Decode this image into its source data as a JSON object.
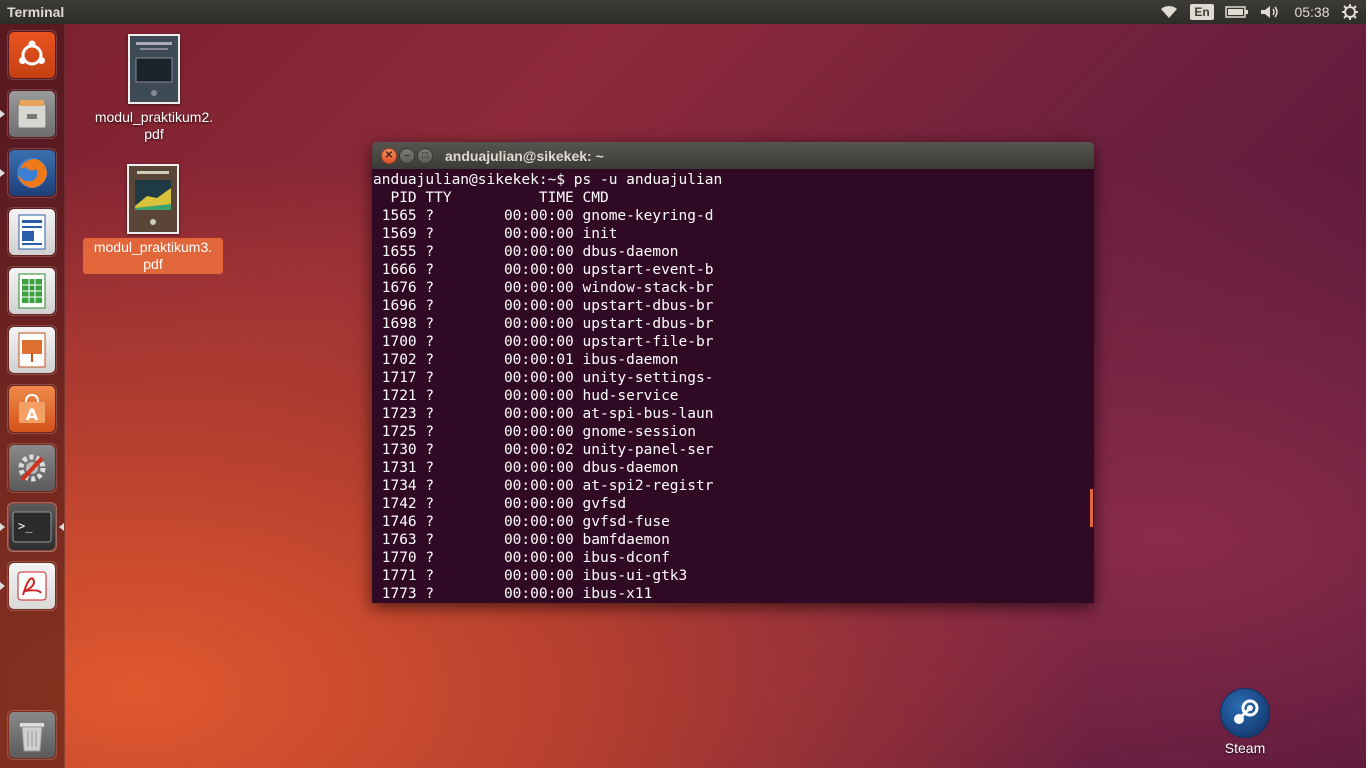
{
  "top_panel": {
    "app_title": "Terminal",
    "keyboard_layout": "En",
    "clock": "05:38"
  },
  "launcher": {
    "items": [
      {
        "name": "Dash",
        "icon": "ubuntu-logo-icon"
      },
      {
        "name": "Files",
        "icon": "file-cabinet-icon"
      },
      {
        "name": "Firefox Web Browser",
        "icon": "firefox-icon"
      },
      {
        "name": "LibreOffice Writer",
        "icon": "writer-icon"
      },
      {
        "name": "LibreOffice Calc",
        "icon": "calc-icon"
      },
      {
        "name": "LibreOffice Impress",
        "icon": "impress-icon"
      },
      {
        "name": "Ubuntu Software Center",
        "icon": "software-center-icon"
      },
      {
        "name": "System Settings",
        "icon": "settings-wrench-icon"
      },
      {
        "name": "Terminal",
        "icon": "terminal-icon"
      },
      {
        "name": "Document Viewer",
        "icon": "pdf-viewer-icon"
      },
      {
        "name": "Trash",
        "icon": "trash-icon"
      }
    ]
  },
  "desktop": {
    "files": [
      {
        "label_line1": "modul_praktikum2.",
        "label_line2": "pdf"
      },
      {
        "label_line1": "modul_praktikum3.",
        "label_line2": "pdf"
      }
    ],
    "steam_label": "Steam"
  },
  "terminal": {
    "window_title": "anduajulian@sikekek: ~",
    "prompt_line": "anduajulian@sikekek:~$ ps -u anduajulian",
    "header": "  PID TTY          TIME CMD",
    "rows": [
      " 1565 ?        00:00:00 gnome-keyring-d",
      " 1569 ?        00:00:00 init",
      " 1655 ?        00:00:00 dbus-daemon",
      " 1666 ?        00:00:00 upstart-event-b",
      " 1676 ?        00:00:00 window-stack-br",
      " 1696 ?        00:00:00 upstart-dbus-br",
      " 1698 ?        00:00:00 upstart-dbus-br",
      " 1700 ?        00:00:00 upstart-file-br",
      " 1702 ?        00:00:01 ibus-daemon",
      " 1717 ?        00:00:00 unity-settings-",
      " 1721 ?        00:00:00 hud-service",
      " 1723 ?        00:00:00 at-spi-bus-laun",
      " 1725 ?        00:00:00 gnome-session",
      " 1730 ?        00:00:02 unity-panel-ser",
      " 1731 ?        00:00:00 dbus-daemon",
      " 1734 ?        00:00:00 at-spi2-registr",
      " 1742 ?        00:00:00 gvfsd",
      " 1746 ?        00:00:00 gvfsd-fuse",
      " 1763 ?        00:00:00 bamfdaemon",
      " 1770 ?        00:00:00 ibus-dconf",
      " 1771 ?        00:00:00 ibus-ui-gtk3",
      " 1773 ?        00:00:00 ibus-x11"
    ]
  }
}
